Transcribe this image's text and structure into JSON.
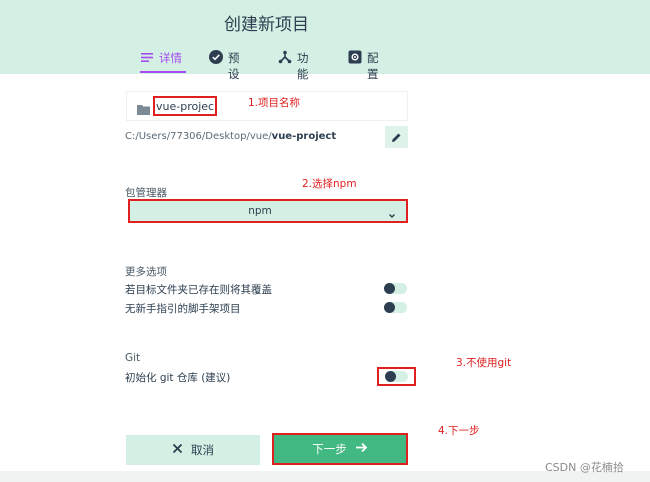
{
  "header": {
    "title": "创建新项目",
    "tabs": [
      {
        "label": "详情",
        "icon": "list-icon",
        "active": true
      },
      {
        "label": "预设",
        "icon": "check-circle-icon",
        "active": false
      },
      {
        "label": "功能",
        "icon": "fork-icon",
        "active": false
      },
      {
        "label": "配置",
        "icon": "settings-box-icon",
        "active": false
      }
    ]
  },
  "project": {
    "folder_icon": "folder-icon",
    "name_value": "vue-project",
    "path_prefix": "C:/Users/77306/Desktop/vue/",
    "path_name": "vue-project",
    "edit_icon": "pencil-icon"
  },
  "package_manager": {
    "label": "包管理器",
    "selected": "npm",
    "chevron_icon": "chevron-down-icon"
  },
  "more_options": {
    "label": "更多选项",
    "items": [
      {
        "label": "若目标文件夹已存在则将其覆盖",
        "enabled": false
      },
      {
        "label": "无新手指引的脚手架项目",
        "enabled": false
      }
    ]
  },
  "git": {
    "label": "Git",
    "option": "初始化 git 仓库 (建议)",
    "enabled": false
  },
  "actions": {
    "cancel_label": "取消",
    "next_label": "下一步"
  },
  "annotations": {
    "a1": "1.项目名称",
    "a2": "2.选择npm",
    "a3": "3.不使用git",
    "a4": "4.下一步"
  },
  "watermark": "CSDN @花楠拾",
  "colors": {
    "accent_green": "#42b983",
    "header_bg": "#d4efe3",
    "active_tab": "#a44cf0",
    "annotation_red": "#e02020"
  }
}
